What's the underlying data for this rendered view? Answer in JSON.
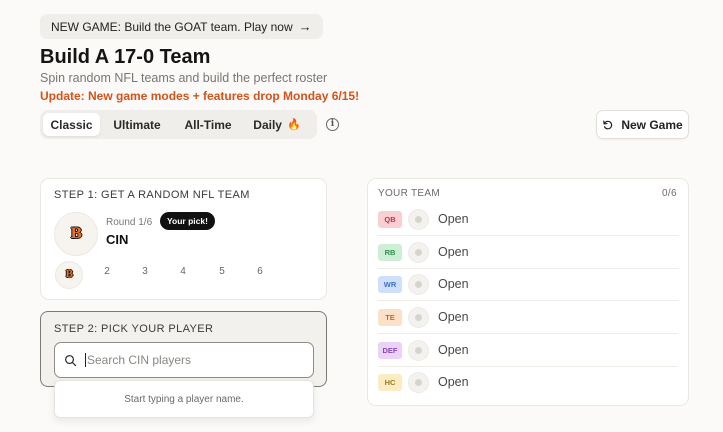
{
  "banner": {
    "text": "NEW GAME: Build the GOAT team. Play now",
    "arrow": "→"
  },
  "header": {
    "title": "Build A 17-0 Team",
    "subtitle": "Spin random NFL teams and build the perfect roster",
    "update": "Update: New game modes + features drop Monday 6/15!"
  },
  "modes": {
    "tabs": [
      {
        "label": "Classic",
        "active": true
      },
      {
        "label": "Ultimate",
        "active": false
      },
      {
        "label": "All-Time",
        "active": false
      },
      {
        "label": "Daily",
        "active": false,
        "icon": "flame-icon"
      }
    ],
    "info_icon": "info-icon"
  },
  "new_game": {
    "label": "New Game",
    "icon": "refresh-icon"
  },
  "step1": {
    "label": "STEP 1: GET A RANDOM NFL TEAM",
    "round": "Round 1/6",
    "pick_badge": "Your pick!",
    "team_code": "CIN",
    "logo": "BENGALS-LOGO",
    "rounds": [
      "2",
      "3",
      "4",
      "5",
      "6"
    ]
  },
  "step2": {
    "label": "STEP 2: PICK YOUR PLAYER",
    "search_placeholder": "Search CIN players",
    "search_value": "",
    "hint": "Start typing a player name."
  },
  "team": {
    "title": "YOUR TEAM",
    "count": "0/6",
    "slots": [
      {
        "pos": "QB",
        "status": "Open",
        "bg": "#f9cfd4",
        "fg": "#b8374a"
      },
      {
        "pos": "RB",
        "status": "Open",
        "bg": "#cfeed6",
        "fg": "#2f8f4b"
      },
      {
        "pos": "WR",
        "status": "Open",
        "bg": "#cfe0fb",
        "fg": "#3f6fc4"
      },
      {
        "pos": "TE",
        "status": "Open",
        "bg": "#fde0c8",
        "fg": "#c26a25"
      },
      {
        "pos": "DEF",
        "status": "Open",
        "bg": "#ead3f7",
        "fg": "#8b46b8"
      },
      {
        "pos": "HC",
        "status": "Open",
        "bg": "#fbecc4",
        "fg": "#9a7a19"
      }
    ]
  }
}
